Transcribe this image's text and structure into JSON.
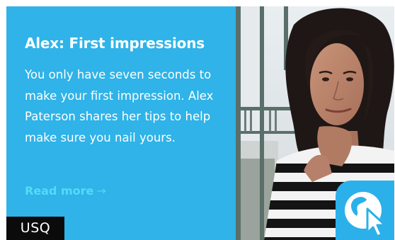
{
  "card": {
    "title": "Alex: First impressions",
    "description": "You only have seven seconds to make your first impression. Alex Paterson shares her tips to help make sure you nail yours.",
    "read_more_label": "Read more",
    "read_more_arrow": "→",
    "badge": "USQ",
    "link_icon": "globe-cursor-icon"
  },
  "colors": {
    "panel_background": "#2fb3e8",
    "read_more": "#51dcf6",
    "badge_background": "#0b0b0b",
    "web_button": "#2bb0ea"
  }
}
